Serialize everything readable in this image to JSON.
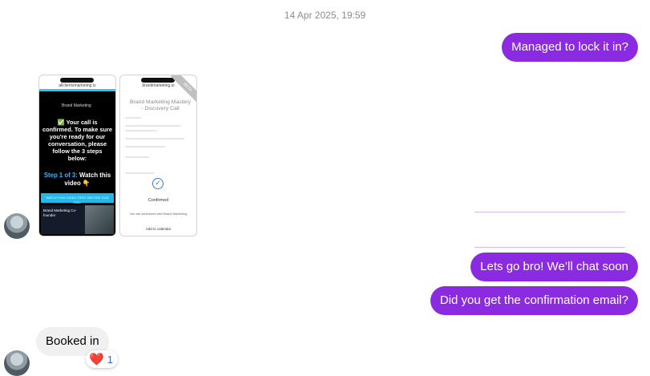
{
  "timestamp": "14 Apr 2025, 19:59",
  "messages": {
    "out_1": "Managed to lock it in?",
    "out_2": "Lets go bro! We’ll chat soon",
    "out_3": "Did you get the confirmation email?",
    "in_1": "Booked in"
  },
  "reaction": {
    "emoji": "❤️",
    "count": "1"
  },
  "screenshot_1": {
    "url": "allclientsmarketing.io",
    "brand": "Brand Marketing",
    "confirmation": "✅ Your call is confirmed. To make sure you're ready for our conversation, please follow the 3 steps below:",
    "step_label": "Step 1 of 3:",
    "step_text": " Watch this video 👇",
    "bar_text": "WATCH THIS VIDEO FIRST BEFORE OUR CALL",
    "video_caption": "Brand Marketing Co-founder"
  },
  "screenshot_2": {
    "url": "brandmarketing.io",
    "title": "Brand Marketing Mastery - Discovery Call",
    "ribbon": "BETA",
    "check": "✓",
    "confirmed": "Confirmed",
    "footer": "You are scheduled with Brand Marketing",
    "footer2": "Add to calendar"
  },
  "colors": {
    "outgoing": "#8a2be2",
    "incoming": "#f0f0f0",
    "accent": "#1b74e4"
  }
}
